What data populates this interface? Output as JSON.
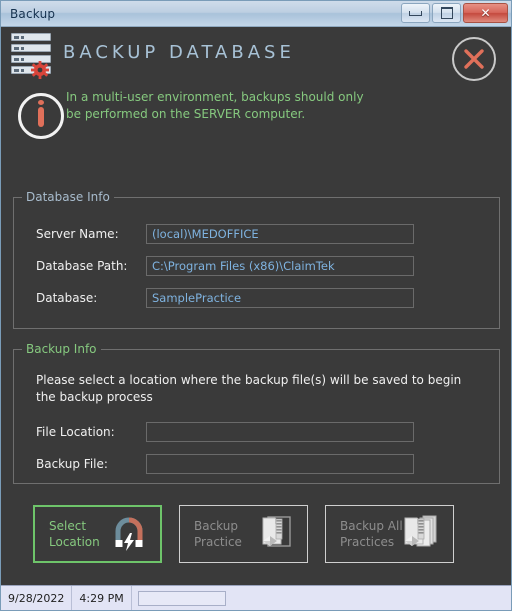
{
  "window": {
    "title": "Backup",
    "controls": {
      "minimize": "minimize-button",
      "maximize": "maximize-button",
      "close": "close-button"
    }
  },
  "header": {
    "title": "BACKUP DATABASE",
    "icon": "server-database-gear-icon",
    "close_icon": "close-circle-x-icon",
    "accent_color": "#a8c2d6"
  },
  "notice": {
    "icon": "info-icon",
    "text": "In a multi-user environment, backups should only be performed on the SERVER computer.",
    "color": "#86c97f"
  },
  "database_info": {
    "legend": "Database Info",
    "fields": [
      {
        "label": "Server Name:",
        "value": "(local)\\MEDOFFICE"
      },
      {
        "label": "Database Path:",
        "value": "C:\\Program Files (x86)\\ClaimTek"
      },
      {
        "label": "Database:",
        "value": "SamplePractice"
      }
    ],
    "value_color": "#7fb3e0"
  },
  "backup_info": {
    "legend": "Backup Info",
    "description": "Please select a location where the backup file(s) will be saved to begin the backup process",
    "fields": [
      {
        "label": "File Location:",
        "value": "",
        "placeholder": ""
      },
      {
        "label": "Backup File:",
        "value": "",
        "placeholder": ""
      }
    ]
  },
  "buttons": [
    {
      "line1": "Select",
      "line2": "Location",
      "icon": "magnet-icon",
      "state": "enabled"
    },
    {
      "line1": "Backup",
      "line2": "Practice",
      "icon": "zip-file-icon",
      "state": "disabled"
    },
    {
      "line1": "Backup All",
      "line2": "Practices",
      "icon": "zip-files-icon",
      "state": "disabled"
    }
  ],
  "statusbar": {
    "date": "9/28/2022",
    "time": "4:29 PM",
    "progress": 0
  }
}
